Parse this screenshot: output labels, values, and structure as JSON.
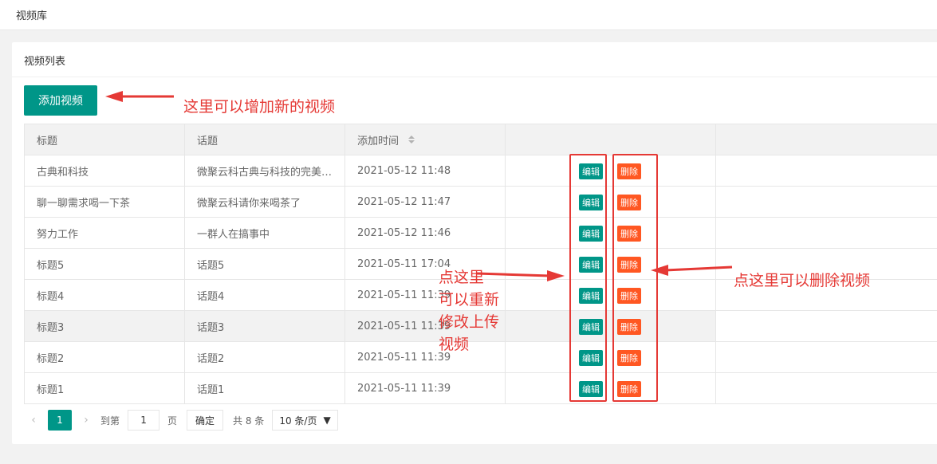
{
  "breadcrumb": "视频库",
  "card": {
    "title": "视频列表",
    "add_button": "添加视频"
  },
  "table": {
    "headers": [
      "标题",
      "话题",
      "添加时间"
    ],
    "edit_label": "编辑",
    "delete_label": "删除",
    "rows": [
      {
        "title": "古典和科技",
        "topic": "微聚云科古典与科技的完美结合",
        "time": "2021-05-12 11:48"
      },
      {
        "title": "聊一聊需求喝一下茶",
        "topic": "微聚云科请你来喝茶了",
        "time": "2021-05-12 11:47"
      },
      {
        "title": "努力工作",
        "topic": "一群人在搞事中",
        "time": "2021-05-12 11:46"
      },
      {
        "title": "标题5",
        "topic": "话题5",
        "time": "2021-05-11 17:04"
      },
      {
        "title": "标题4",
        "topic": "话题4",
        "time": "2021-05-11 11:39"
      },
      {
        "title": "标题3",
        "topic": "话题3",
        "time": "2021-05-11 11:39"
      },
      {
        "title": "标题2",
        "topic": "话题2",
        "time": "2021-05-11 11:39"
      },
      {
        "title": "标题1",
        "topic": "话题1",
        "time": "2021-05-11 11:39"
      }
    ]
  },
  "pager": {
    "current": "1",
    "goto_prefix": "到第",
    "goto_value": "1",
    "goto_suffix": "页",
    "confirm": "确定",
    "total": "共 8 条",
    "page_size": "10 条/页"
  },
  "annotations": {
    "add": "这里可以增加新的视频",
    "edit_lines": [
      "点这里",
      "可以重新",
      "修改上传",
      "视频"
    ],
    "delete": "点这里可以删除视频"
  },
  "colors": {
    "primary": "#009688",
    "danger": "#ff5722",
    "annotation": "#e53935"
  }
}
